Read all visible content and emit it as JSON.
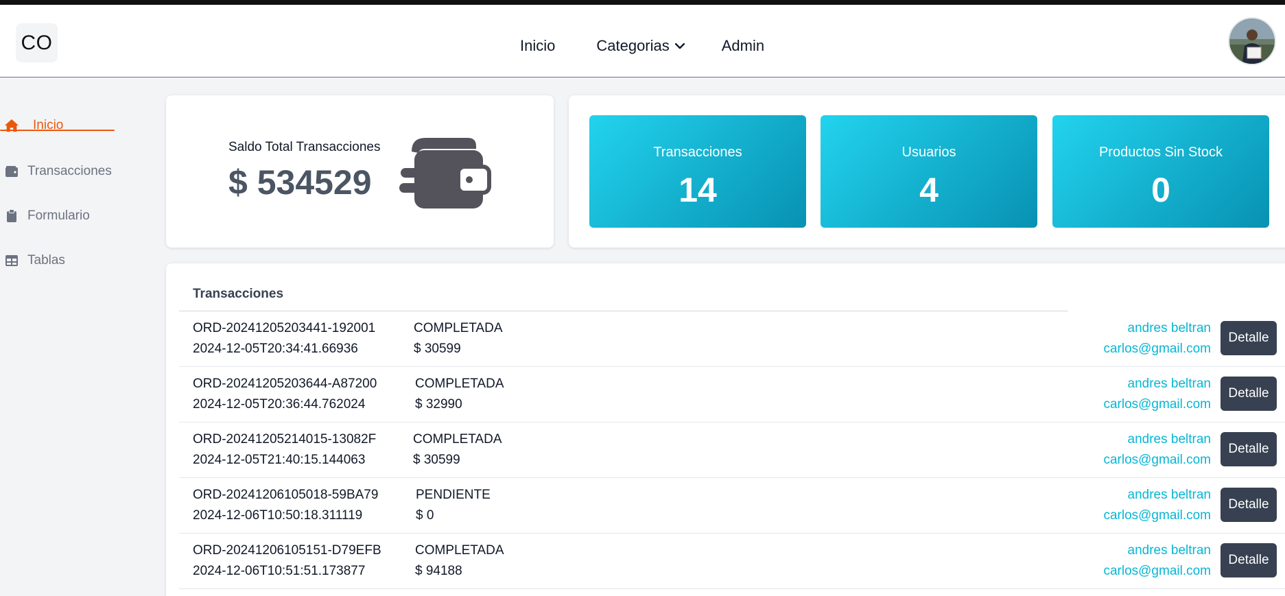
{
  "navbar": {
    "logo": "CO",
    "links": [
      "Inicio",
      "Categorias",
      "Admin"
    ]
  },
  "sidebar": {
    "items": [
      {
        "label": "Inicio",
        "icon": "home-icon",
        "active": true
      },
      {
        "label": "Transacciones",
        "icon": "wallet-icon",
        "active": false
      },
      {
        "label": "Formulario",
        "icon": "clipboard-icon",
        "active": false
      },
      {
        "label": "Tablas",
        "icon": "table-icon",
        "active": false
      }
    ]
  },
  "balance": {
    "label": "Saldo Total Transacciones",
    "value": "$ 534529",
    "icon": "wallet-icon"
  },
  "stats": [
    {
      "label": "Transacciones",
      "value": "14"
    },
    {
      "label": "Usuarios",
      "value": "4"
    },
    {
      "label": "Productos Sin Stock",
      "value": "0"
    }
  ],
  "table": {
    "title": "Transacciones",
    "button_label": "Detalle",
    "rows": [
      {
        "id": "ORD-20241205203441-192001",
        "date": "2024-12-05T20:34:41.66936",
        "status": "COMPLETADA",
        "amount": "$ 30599",
        "user": "andres beltran",
        "email": "carlos@gmail.com"
      },
      {
        "id": "ORD-20241205203644-A87200",
        "date": "2024-12-05T20:36:44.762024",
        "status": "COMPLETADA",
        "amount": "$ 32990",
        "user": "andres beltran",
        "email": "carlos@gmail.com"
      },
      {
        "id": "ORD-20241205214015-13082F",
        "date": "2024-12-05T21:40:15.144063",
        "status": "COMPLETADA",
        "amount": "$ 30599",
        "user": "andres beltran",
        "email": "carlos@gmail.com"
      },
      {
        "id": "ORD-20241206105018-59BA79",
        "date": "2024-12-06T10:50:18.311119",
        "status": "PENDIENTE",
        "amount": "$ 0",
        "user": "andres beltran",
        "email": "carlos@gmail.com"
      },
      {
        "id": "ORD-20241206105151-D79EFB",
        "date": "2024-12-06T10:51:51.173877",
        "status": "COMPLETADA",
        "amount": "$ 94188",
        "user": "andres beltran",
        "email": "carlos@gmail.com"
      }
    ]
  },
  "colors": {
    "accent": "#ea580c",
    "stat_gradient_start": "#22d3ee",
    "stat_gradient_end": "#0891b2",
    "link": "#06b6d4",
    "button": "#374151"
  }
}
